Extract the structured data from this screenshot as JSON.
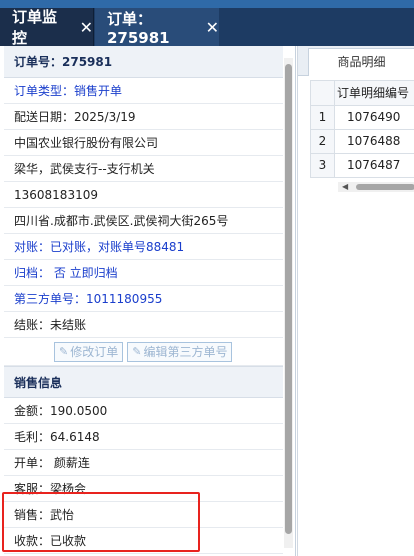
{
  "tabs": [
    {
      "label": "订单监控",
      "close": "✕"
    },
    {
      "label": "订单：275981",
      "close": "✕"
    }
  ],
  "order": {
    "number": "订单号：275981",
    "type": "订单类型：销售开单",
    "delivery_date": "配送日期：2025/3/19",
    "bank": "中国农业银行股份有限公司",
    "branch": "梁华，武侯支行--支行机关",
    "phone": "13608183109",
    "address": "四川省.成都市.武侯区.武侯祠大街265号",
    "reconcile": "对账：已对账，对账单号88481",
    "archive": "归档： 否 立即归档",
    "third_party": "第三方单号：1011180955",
    "settle": "结账：未结账",
    "edit_order_label": "修改订单",
    "edit_third_party_label": "编辑第三方单号"
  },
  "sales_info": {
    "title": "销售信息",
    "amount": "金额：190.0500",
    "profit": "毛利：64.6148",
    "opener": "开单： 颜薪连",
    "service": "客服：梁杨会",
    "seller": "销售：武怡",
    "collection": "收款：已收款"
  },
  "right": {
    "tab_label": "商品明细",
    "column_header": "订单明细编号",
    "rows": [
      {
        "n": "1",
        "id": "1076490"
      },
      {
        "n": "2",
        "id": "1076488"
      },
      {
        "n": "3",
        "id": "1076487"
      }
    ],
    "scroll_left": "◀"
  },
  "colors": {
    "tabbar": "#1d3b63",
    "link_blue": "#1a3ecc",
    "highlight": "#e8231e"
  }
}
